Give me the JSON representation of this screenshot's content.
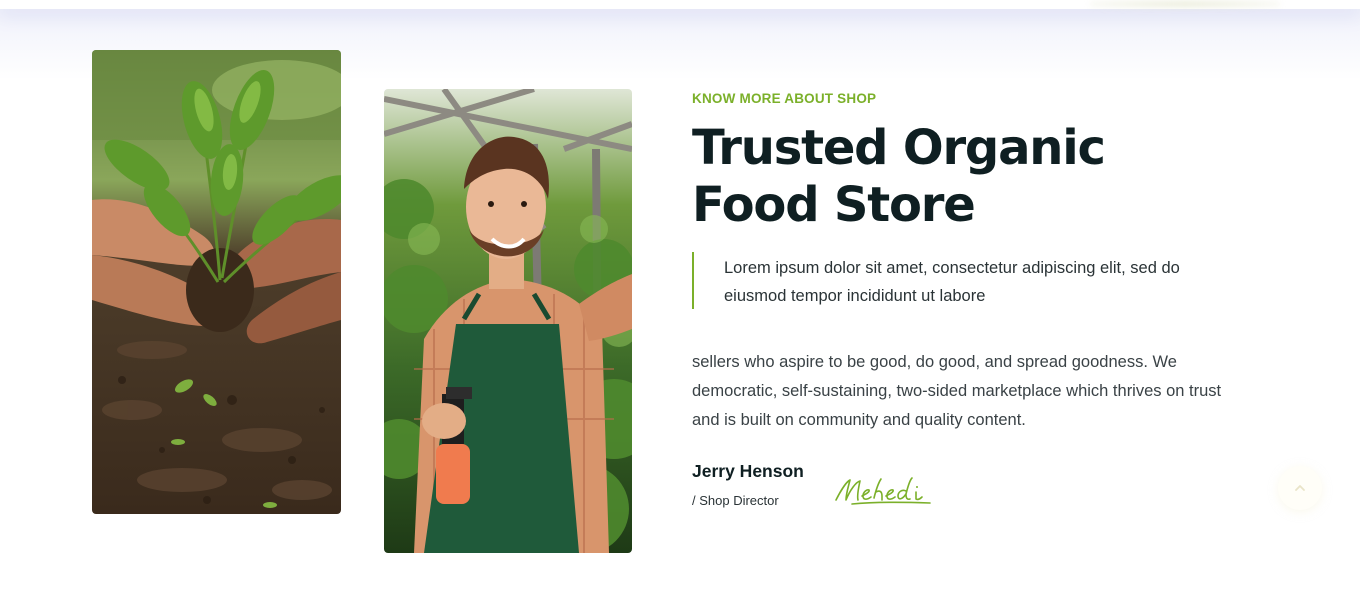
{
  "section": {
    "eyebrow": "KNOW MORE ABOUT SHOP",
    "title": "Trusted Organic Food Store",
    "quote": "Lorem ipsum dolor sit amet, consectetur adipiscing elit, sed do eiusmod tempor incididunt ut labore",
    "body": "sellers who aspire to be good, do good, and spread goodness. We democratic, self-sustaining, two-sided marketplace which thrives on trust and is built on community and quality content.",
    "author": {
      "name": "Jerry Henson",
      "role": "/ Shop Director",
      "signature": "Mehedi"
    }
  },
  "images": {
    "left": "hands-holding-seedling-photo",
    "right": "gardener-with-spray-bottle-photo"
  },
  "colors": {
    "accent": "#7bb02a",
    "heading": "#0f1f22",
    "text": "#3a4246"
  },
  "icons": {
    "scroll_top": "chevron-up-icon"
  }
}
